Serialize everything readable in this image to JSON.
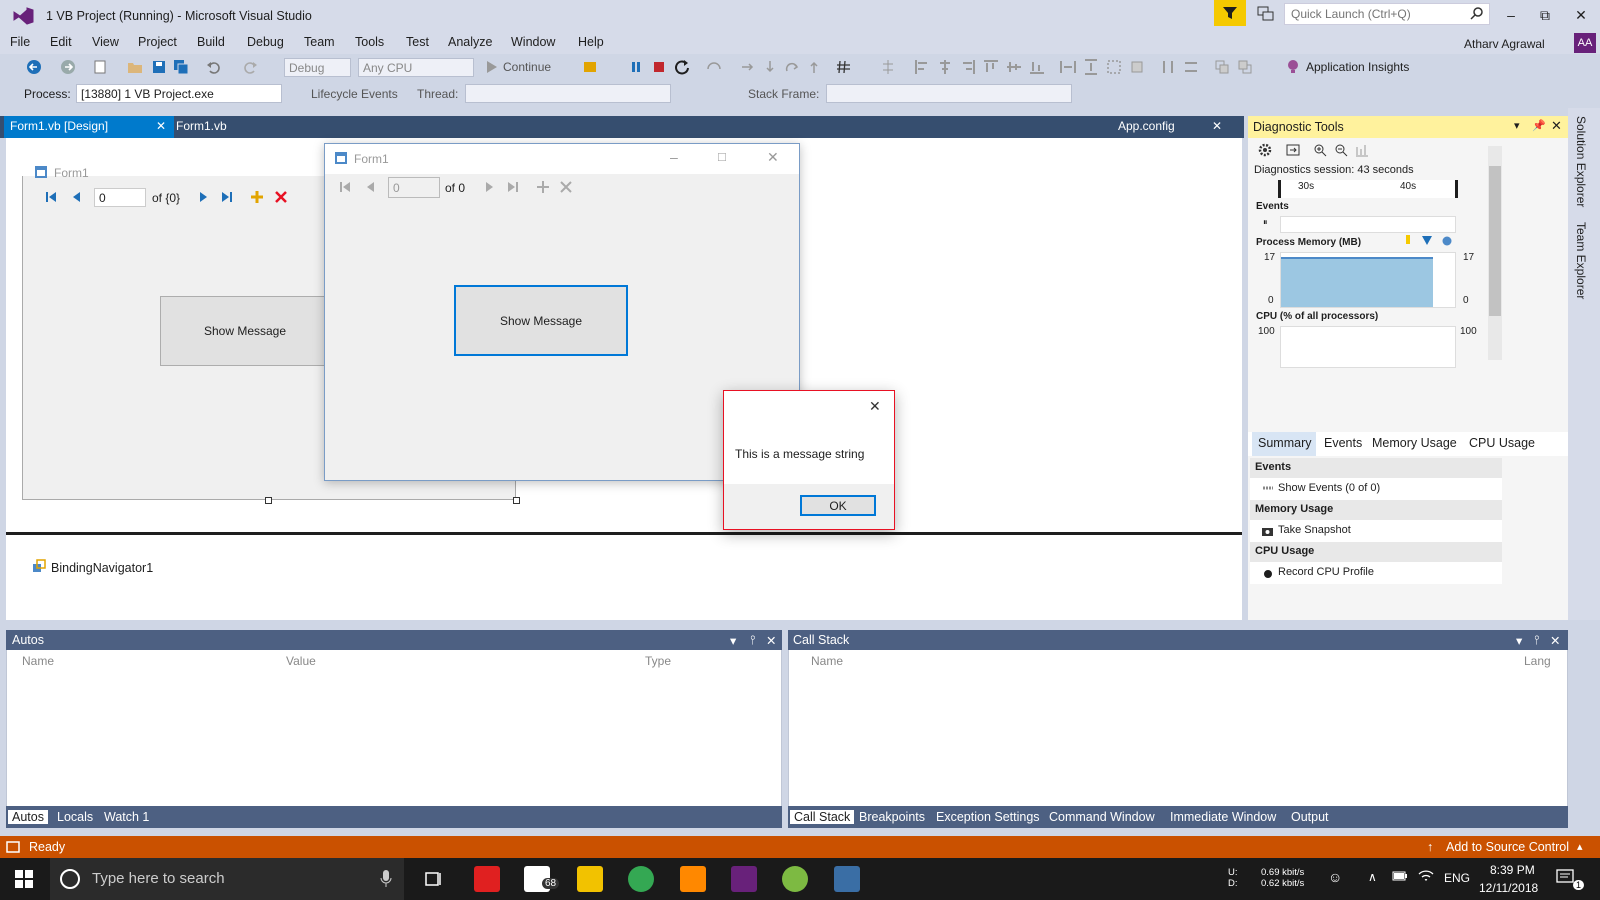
{
  "window": {
    "title": "1 VB Project (Running) - Microsoft Visual Studio",
    "quick_launch_placeholder": "Quick Launch (Ctrl+Q)",
    "user": "Atharv Agrawal",
    "user_initials": "AA"
  },
  "menu": [
    "File",
    "Edit",
    "View",
    "Project",
    "Build",
    "Debug",
    "Team",
    "Tools",
    "Test",
    "Analyze",
    "Window",
    "Help"
  ],
  "toolbar": {
    "config": "Debug",
    "platform": "Any CPU",
    "continue_label": "Continue",
    "app_insights": "Application Insights",
    "process_label": "Process:",
    "process_value": "[13880] 1 VB Project.exe",
    "lifecycle": "Lifecycle Events",
    "thread_label": "Thread:",
    "stack_frame_label": "Stack Frame:"
  },
  "doc_tabs": {
    "design_tab": "Form1.vb [Design]",
    "code_tab": "Form1.vb",
    "app_config": "App.config"
  },
  "designer": {
    "form_title": "Form1",
    "nav_position": "0",
    "nav_count": "of {0}",
    "button_label": "Show Message",
    "component": "BindingNavigator1"
  },
  "running_form": {
    "title": "Form1",
    "nav_position": "0",
    "nav_count": "of 0",
    "button_label": "Show Message"
  },
  "message_box": {
    "text": "This is a message string",
    "ok": "OK"
  },
  "diagnostics": {
    "title": "Diagnostic Tools",
    "session": "Diagnostics session: 43 seconds",
    "tick_30": "30s",
    "tick_40": "40s",
    "events_label": "Events",
    "memory_label": "Process Memory (MB)",
    "mem_max": "17",
    "mem_min": "0",
    "cpu_label": "CPU (% of all processors)",
    "cpu_max": "100",
    "tabs": [
      "Summary",
      "Events",
      "Memory Usage",
      "CPU Usage"
    ],
    "sec_events": "Events",
    "show_events": "Show Events (0 of 0)",
    "sec_memory": "Memory Usage",
    "take_snapshot": "Take Snapshot",
    "sec_cpu": "CPU Usage",
    "record_cpu": "Record CPU Profile"
  },
  "autos": {
    "title": "Autos",
    "columns": [
      "Name",
      "Value",
      "Type"
    ],
    "tabs": [
      "Autos",
      "Locals",
      "Watch 1"
    ]
  },
  "callstack": {
    "title": "Call Stack",
    "columns": [
      "Name",
      "Lang"
    ],
    "tabs": [
      "Call Stack",
      "Breakpoints",
      "Exception Settings",
      "Command Window",
      "Immediate Window",
      "Output"
    ]
  },
  "side_rail": [
    "Solution Explorer",
    "Team Explorer"
  ],
  "status": {
    "text": "Ready",
    "source_control": "Add to Source Control"
  },
  "taskbar": {
    "search_placeholder": "Type here to search",
    "mail_badge": "68",
    "net_up_label": "U:",
    "net_down_label": "D:",
    "net_up": "0.69 kbit/s",
    "net_down": "0.62 kbit/s",
    "lang": "ENG",
    "time": "8:39 PM",
    "date": "12/11/2018",
    "notif_count": "1"
  },
  "colors": {
    "accent": "#007acc",
    "status_orange": "#ca5100",
    "pane_title": "#4d6082",
    "diag_title": "#fff29d"
  }
}
